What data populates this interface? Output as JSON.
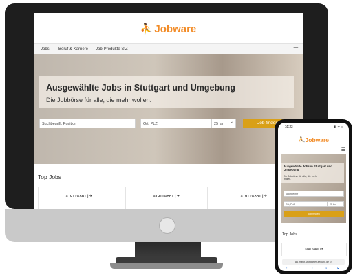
{
  "desktop": {
    "logo": "Jobware",
    "logo_mark": "⛹",
    "nav": [
      "Jobs",
      "Beruf & Karriere",
      "Job-Produkte StZ"
    ],
    "menu_icon": "☰",
    "hero_title": "Ausgewählte Jobs in Stuttgart und Umgebung",
    "hero_subtitle": "Die Jobbörse für alle, die mehr wollen.",
    "search_placeholder": "Suchbegriff, Position",
    "location_placeholder": "Ort, PLZ",
    "radius": "25 km",
    "radius_chevron": "⌄",
    "search_button": "Job finden",
    "section_title": "Top Jobs",
    "card_label": "STUTTGART | ✈"
  },
  "mobile": {
    "time": "10:23",
    "status_icons": "▮▮ ᯤ ▭",
    "logo": "Jobware",
    "logo_mark": "⛹",
    "menu_icon": "☰",
    "hero_title": "Ausgewählte Jobs in Stuttgart und Umgebung",
    "hero_subtitle": "Die Jobbörse für alle, die mehr wollen.",
    "search_placeholder": "Suchbegriff",
    "location_placeholder": "Ort, PLZ",
    "radius": "25 km",
    "search_button": "Job finden",
    "section_title": "Top Jobs",
    "card_label": "STUTTGART | ✈",
    "url": "aA  markt.stuttgarter-zeitung.de  ↻",
    "toolbar": [
      "‹",
      "›",
      "⇪",
      "⊡",
      "⧉"
    ]
  },
  "colors": {
    "accent": "#f28c28",
    "brand_dark": "#1e3c6e",
    "button": "#d9a018"
  }
}
